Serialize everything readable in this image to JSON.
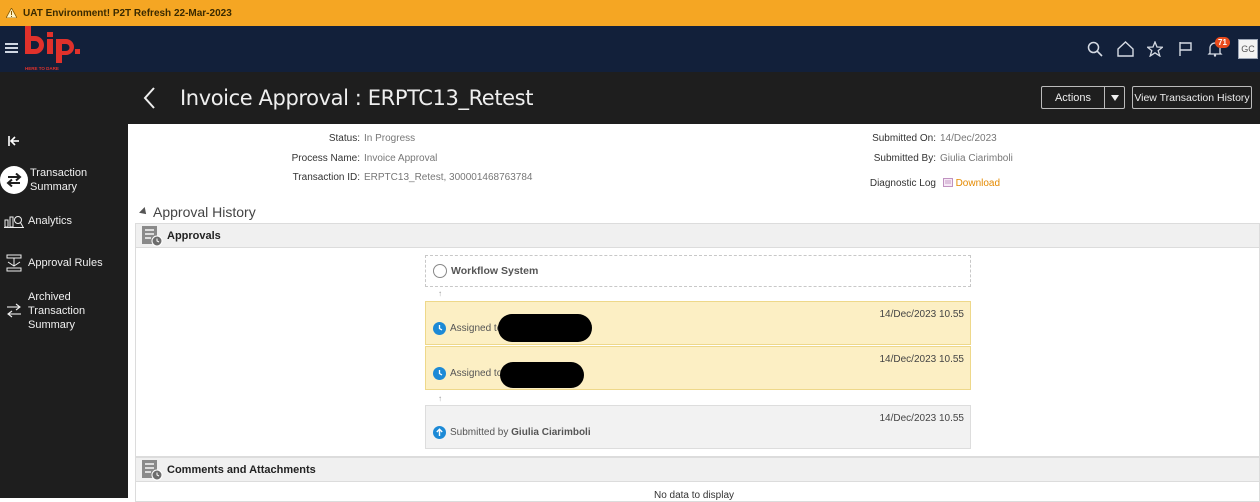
{
  "banner": {
    "text": "UAT Environment! P2T Refresh 22-Mar-2023",
    "color": "#f5a623"
  },
  "brand": {
    "logo_text": "bip.",
    "tagline": "HERE TO DARE",
    "accent": "#e0312b"
  },
  "header_icons": {
    "search": "search-icon",
    "home": "home-icon",
    "favorites": "star-icon",
    "flag": "flag-icon",
    "notifications": "bell-icon",
    "notification_count": "71",
    "user_initials": "GC"
  },
  "title_bar": {
    "title": "Invoice Approval : ERPTC13_Retest",
    "actions_label": "Actions",
    "history_label": "View Transaction History"
  },
  "sidebar": {
    "items": [
      {
        "label_1": "Transaction",
        "label_2": "Summary",
        "icon": "swap-icon"
      },
      {
        "label": "Analytics",
        "icon": "analytics-icon"
      },
      {
        "label": "Approval Rules",
        "icon": "rules-icon"
      },
      {
        "label_1": "Archived",
        "label_2": "Transaction",
        "label_3": "Summary",
        "icon": "archive-icon"
      }
    ]
  },
  "summary": {
    "status_label": "Status:",
    "status_value": "In Progress",
    "process_label": "Process Name:",
    "process_value": "Invoice Approval",
    "txn_label": "Transaction ID:",
    "txn_value": "ERPTC13_Retest, 300001468763784",
    "submitted_on_label": "Submitted On:",
    "submitted_on_value": "14/Dec/2023",
    "submitted_by_label": "Submitted By:",
    "submitted_by_value": "Giulia Ciarimboli",
    "diag_label": "Diagnostic Log",
    "diag_link": "Download"
  },
  "approval_history": {
    "section_title": "Approval History",
    "approvals_title": "Approvals",
    "workflow_label": "Workflow System",
    "steps": [
      {
        "timestamp": "14/Dec/2023 10.55",
        "text": "Assigned to"
      },
      {
        "timestamp": "14/Dec/2023 10.55",
        "text": "Assigned to"
      },
      {
        "timestamp": "14/Dec/2023 10.55",
        "text_prefix": "Submitted by",
        "name": "Giulia Ciarimboli"
      }
    ]
  },
  "comments": {
    "title": "Comments and Attachments",
    "empty_text": "No data to display"
  }
}
